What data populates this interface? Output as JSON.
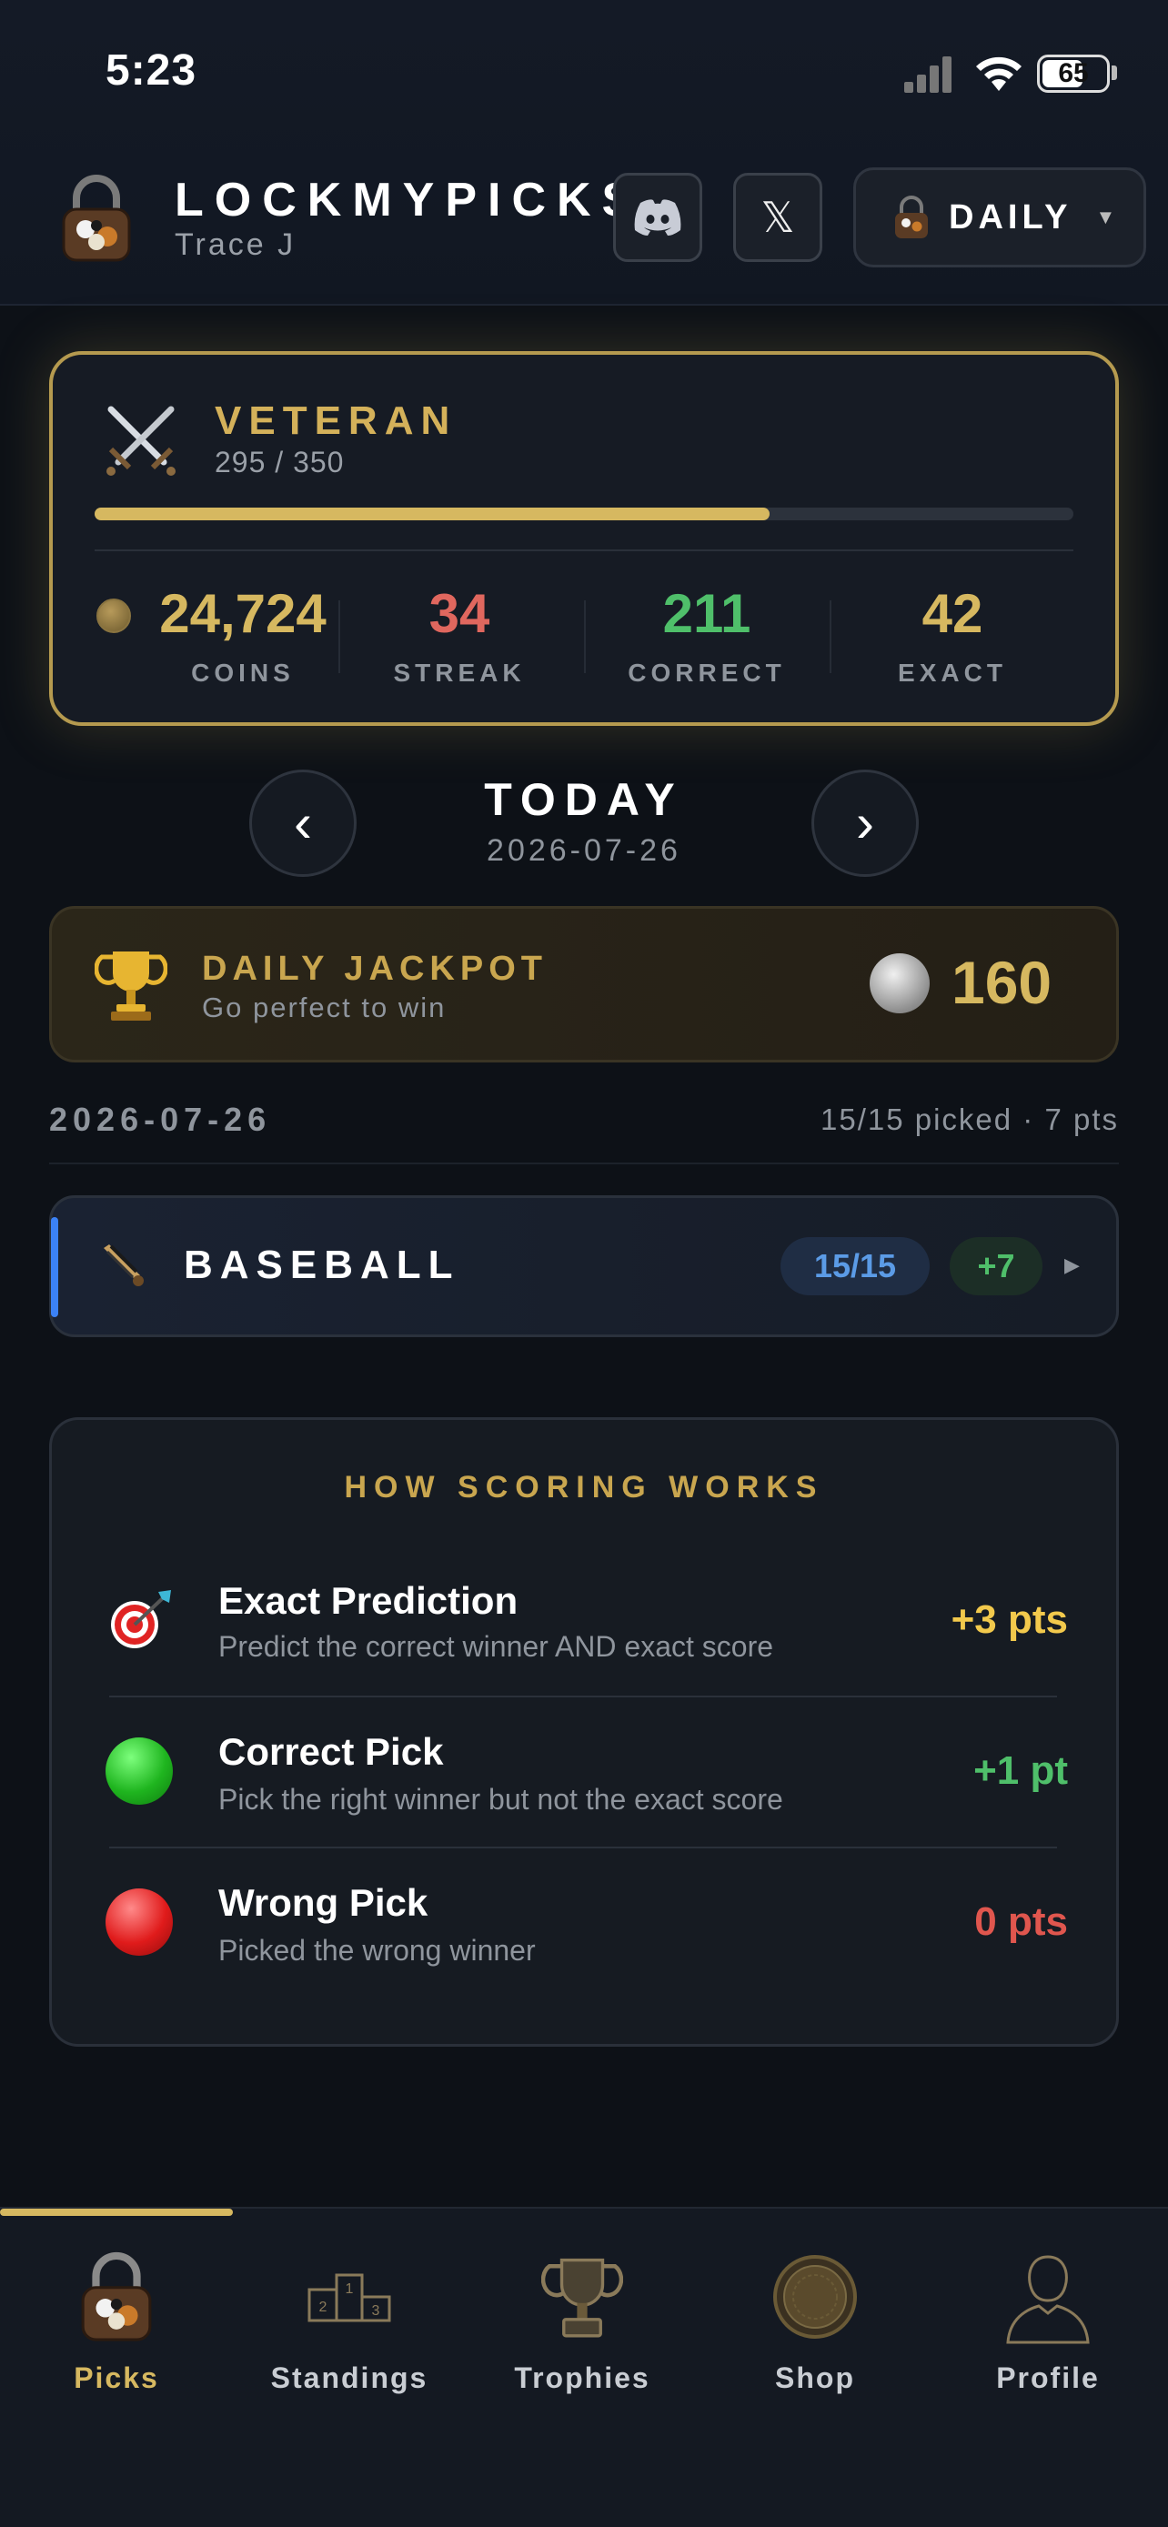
{
  "status_bar": {
    "time": "5:23",
    "battery": "65"
  },
  "header": {
    "brand": "LOCKMYPICKS",
    "user": "Trace J",
    "mode_label": "DAILY",
    "x_label": "𝕏"
  },
  "rank": {
    "title": "VETERAN",
    "xp": "295 / 350",
    "progress_fraction": 0.69,
    "stats": [
      {
        "value": "24,724",
        "label": "COINS",
        "color": "#d6b860"
      },
      {
        "value": "34",
        "label": "STREAK",
        "color": "#e0675e"
      },
      {
        "value": "211",
        "label": "CORRECT",
        "color": "#4fbf6a"
      },
      {
        "value": "42",
        "label": "EXACT",
        "color": "#d6b860"
      }
    ]
  },
  "day_nav": {
    "prev": "‹",
    "next": "›",
    "title": "TODAY",
    "date": "2026-07-26"
  },
  "jackpot": {
    "title": "DAILY JACKPOT",
    "subtitle": "Go perfect to win",
    "amount": "160"
  },
  "summary": {
    "date": "2026-07-26",
    "picked": "15/15 picked · 7 pts"
  },
  "sport": {
    "name": "BASEBALL",
    "count": "15/15",
    "points": "+7",
    "accent": "#3b82f6"
  },
  "scoring": {
    "title": "HOW SCORING WORKS",
    "rows": [
      {
        "icon": "target-icon",
        "title": "Exact Prediction",
        "desc": "Predict the correct winner AND exact score",
        "pts": "+3 pts",
        "color": "#f2c94c"
      },
      {
        "icon": "green-circle-icon",
        "title": "Correct Pick",
        "desc": "Pick the right winner but not the exact score",
        "pts": "+1 pt",
        "color": "#4fbf6a"
      },
      {
        "icon": "red-circle-icon",
        "title": "Wrong Pick",
        "desc": "Picked the wrong winner",
        "pts": "0 pts",
        "color": "#e0564e"
      }
    ]
  },
  "tabs": [
    {
      "label": "Picks",
      "icon": "lock-icon",
      "active": true
    },
    {
      "label": "Standings",
      "icon": "podium-icon",
      "active": false
    },
    {
      "label": "Trophies",
      "icon": "trophy-icon",
      "active": false
    },
    {
      "label": "Shop",
      "icon": "coin-icon",
      "active": false
    },
    {
      "label": "Profile",
      "icon": "person-icon",
      "active": false
    }
  ]
}
